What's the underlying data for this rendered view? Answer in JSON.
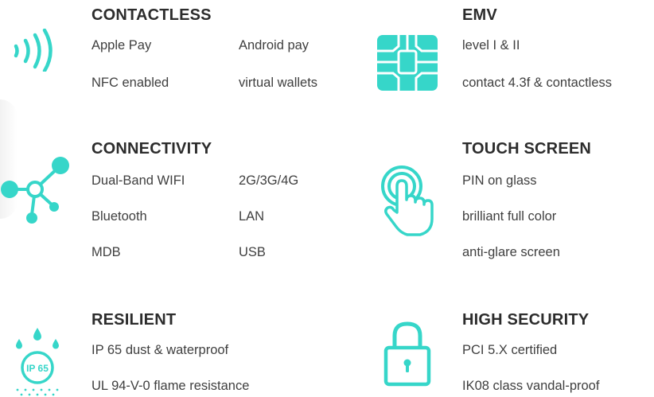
{
  "accent_color": "#36d6c9",
  "features": {
    "contactless": {
      "title": "CONTACTLESS",
      "icon": "nfc-waves-icon",
      "items": [
        "Apple Pay",
        "Android pay",
        "NFC enabled",
        "virtual wallets"
      ]
    },
    "emv": {
      "title": "EMV",
      "icon": "chip-card-icon",
      "items": [
        "level I & II",
        "contact 4.3f & contactless"
      ]
    },
    "connectivity": {
      "title": "CONNECTIVITY",
      "icon": "network-nodes-icon",
      "items": [
        "Dual-Band WIFI",
        "2G/3G/4G",
        "Bluetooth",
        "LAN",
        "MDB",
        "USB"
      ]
    },
    "touch_screen": {
      "title": "TOUCH SCREEN",
      "icon": "touch-hand-icon",
      "items": [
        "PIN on glass",
        "brilliant full color",
        "anti-glare screen"
      ]
    },
    "resilient": {
      "title": "RESILIENT",
      "icon": "ip65-water-drops-icon",
      "icon_label": "IP 65",
      "items": [
        "IP 65 dust & waterproof",
        "UL 94-V-0 flame resistance"
      ]
    },
    "high_security": {
      "title": "HIGH SECURITY",
      "icon": "padlock-icon",
      "items": [
        "PCI 5.X certified",
        "IK08 class vandal-proof"
      ]
    }
  }
}
